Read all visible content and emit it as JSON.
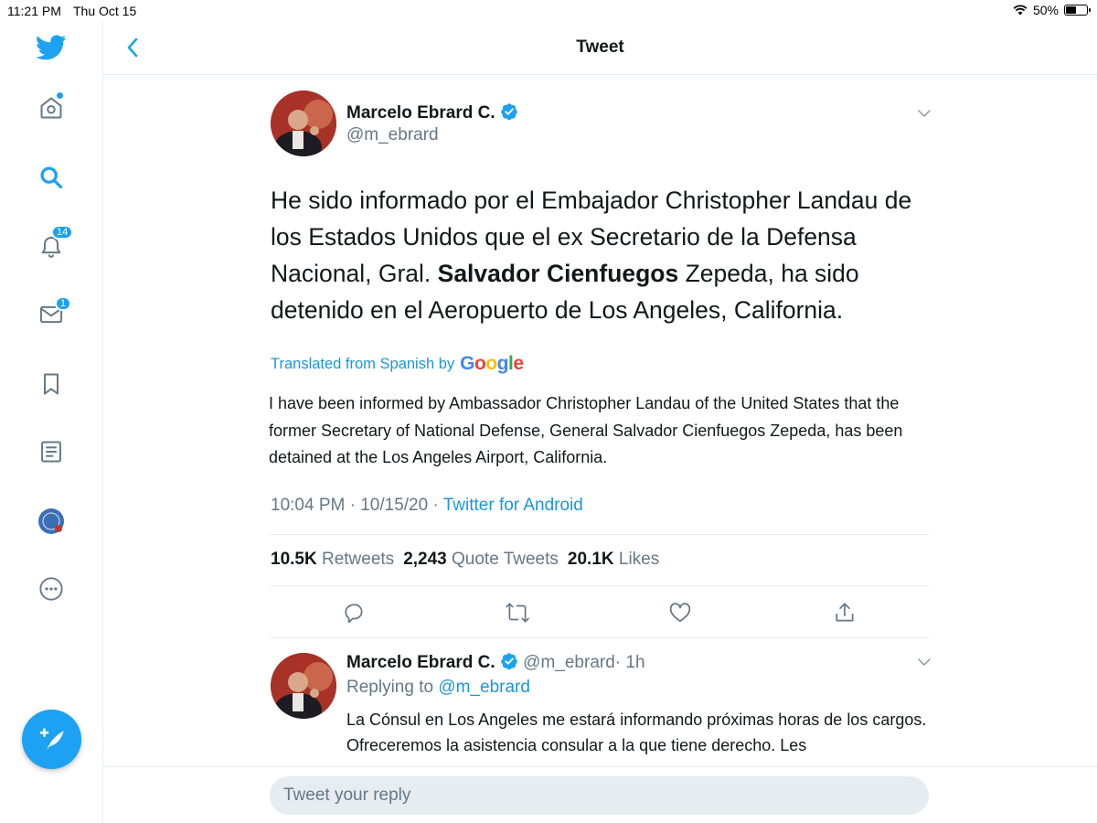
{
  "status_bar": {
    "time": "11:21 PM",
    "date": "Thu Oct 15",
    "battery": "50%",
    "icons": [
      "wifi-icon",
      "battery-icon"
    ]
  },
  "sidebar": {
    "items": [
      {
        "name": "twitter-logo",
        "icon": "twitter-bird-icon"
      },
      {
        "name": "home",
        "icon": "home-icon",
        "has_dot": true
      },
      {
        "name": "explore",
        "icon": "search-icon"
      },
      {
        "name": "notifications",
        "icon": "bell-icon",
        "badge": "14"
      },
      {
        "name": "messages",
        "icon": "envelope-icon",
        "badge": "1"
      },
      {
        "name": "bookmarks",
        "icon": "bookmark-icon"
      },
      {
        "name": "lists",
        "icon": "list-icon"
      },
      {
        "name": "profile",
        "icon": "avatar"
      },
      {
        "name": "more",
        "icon": "more-icon"
      }
    ],
    "compose_icon": "compose-tweet-icon"
  },
  "header": {
    "title": "Tweet",
    "back_icon": "chevron-left-icon"
  },
  "tweet": {
    "author_name": "Marcelo Ebrard C.",
    "author_handle": "@m_ebrard",
    "verified": true,
    "text_before_bold": "He sido informado por el Embajador Christopher Landau de los Estados Unidos que el ex Secretario de la Defensa Nacional, Gral. ",
    "text_bold": "Salvador Cienfuegos",
    "text_after_bold": " Zepeda, ha sido detenido en el Aeropuerto de Los Angeles, California.",
    "translated_label": "Translated from Spanish by",
    "translation_provider": "Google",
    "translation": "I have been informed by Ambassador Christopher Landau of the United States that the former Secretary of National Defense, General Salvador Cienfuegos Zepeda, has been detained at the Los Angeles Airport, California.",
    "timestamp": "10:04 PM · 10/15/20 · ",
    "source": "Twitter for Android",
    "stats": {
      "retweets_count": "10.5K",
      "retweets_label": "Retweets",
      "quotes_count": "2,243",
      "quotes_label": "Quote Tweets",
      "likes_count": "20.1K",
      "likes_label": "Likes"
    },
    "actions": [
      "reply-icon",
      "retweet-icon",
      "like-icon",
      "share-icon"
    ]
  },
  "reply": {
    "author_name": "Marcelo Ebrard C.",
    "author_handle": "@m_ebrard",
    "time": "· 1h",
    "replying_label": "Replying to ",
    "replying_to": "@m_ebrard",
    "text": "La Cónsul en Los Angeles me estará informando próximas horas de los cargos. Ofreceremos la asistencia consular a la que tiene derecho. Les"
  },
  "reply_bar": {
    "placeholder": "Tweet your reply"
  },
  "colors": {
    "accent": "#1da1f2",
    "link": "#1b95e0",
    "secondary_text": "#657786",
    "divider": "#e6ecf0"
  }
}
